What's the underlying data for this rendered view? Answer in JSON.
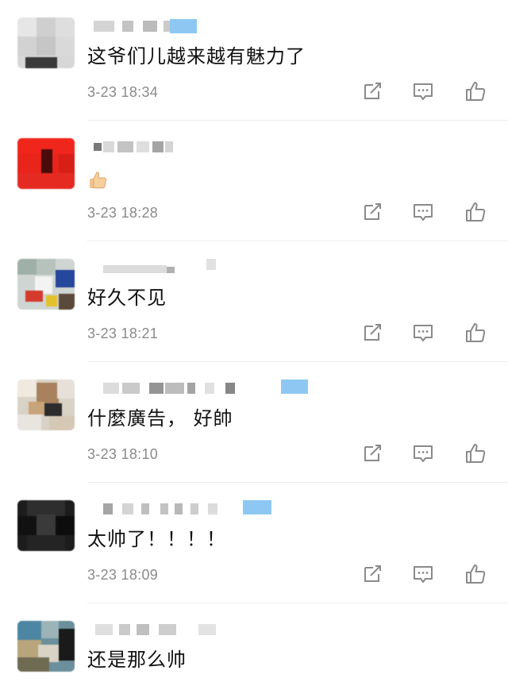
{
  "comments": [
    {
      "text": "这爷们儿越来越有魅力了",
      "time": "3-23 18:34"
    },
    {
      "text": "",
      "emoji": "thumbs-up-emoji",
      "time": "3-23 18:28"
    },
    {
      "text": "好久不见",
      "time": "3-23 18:21"
    },
    {
      "text": "什麼廣告， 好帥",
      "time": "3-23 18:10"
    },
    {
      "text": "太帅了！！！！",
      "time": "3-23 18:09"
    },
    {
      "text": "还是那么帅",
      "time": ""
    }
  ],
  "icons": {
    "share": "share-icon",
    "reply": "comment-icon",
    "like": "thumbs-up-icon"
  },
  "colors": {
    "icon": "#8a8a8a",
    "time": "#8a8a8a",
    "divider": "#ececec",
    "vip_badge": "#8ec8f2"
  }
}
